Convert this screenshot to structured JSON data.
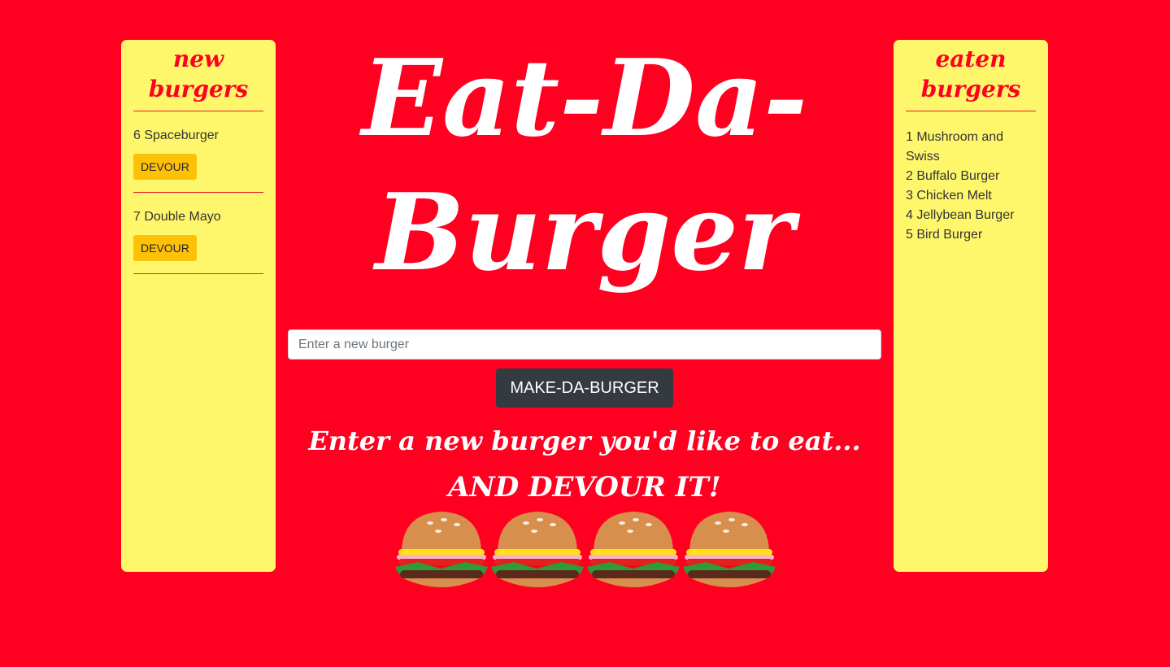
{
  "app": {
    "title": "Eat-Da-Burger",
    "taglines": [
      "Enter a new burger you'd like to eat...",
      "AND DEVOUR IT!"
    ],
    "colors": {
      "background": "#ff0021",
      "panel": "#fff76b",
      "accent": "#ff0021",
      "devour_button": "#ffc107",
      "make_button": "#343a40"
    }
  },
  "new_panel": {
    "title": "new burgers",
    "items": [
      {
        "name": "6 Spaceburger",
        "button": "DEVOUR"
      },
      {
        "name": "7 Double Mayo",
        "button": "DEVOUR"
      }
    ]
  },
  "eaten_panel": {
    "title": "eaten burgers",
    "items": [
      "1 Mushroom and Swiss",
      "2 Buffalo Burger",
      "3 Chicken Melt",
      "4 Jellybean Burger",
      "5 Bird Burger"
    ]
  },
  "form": {
    "placeholder": "Enter a new burger",
    "value": "",
    "submit_label": "MAKE-DA-BURGER"
  },
  "decor": {
    "burger_icon": "burger-icon",
    "burger_count": 4
  }
}
